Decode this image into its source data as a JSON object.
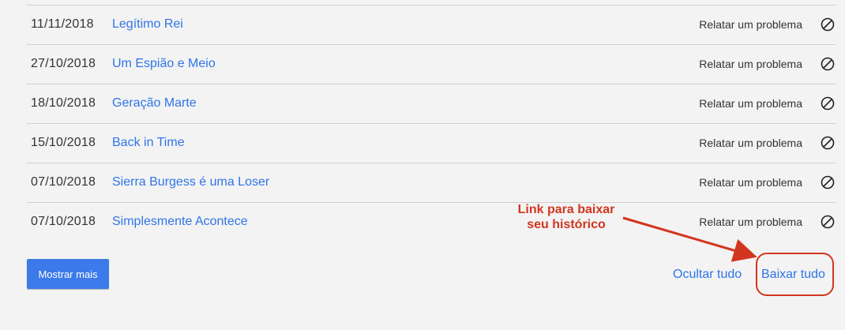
{
  "history": {
    "rows": [
      {
        "date": "11/11/2018",
        "title": "Legítimo Rei",
        "report": "Relatar um problema"
      },
      {
        "date": "27/10/2018",
        "title": "Um Espião e Meio",
        "report": "Relatar um problema"
      },
      {
        "date": "18/10/2018",
        "title": "Geração Marte",
        "report": "Relatar um problema"
      },
      {
        "date": "15/10/2018",
        "title": "Back in Time",
        "report": "Relatar um problema"
      },
      {
        "date": "07/10/2018",
        "title": "Sierra Burgess é uma Loser",
        "report": "Relatar um problema"
      },
      {
        "date": "07/10/2018",
        "title": "Simplesmente Acontece",
        "report": "Relatar um problema"
      }
    ]
  },
  "footer": {
    "show_more_label": "Mostrar mais",
    "hide_all_label": "Ocultar tudo",
    "download_all_label": "Baixar tudo"
  },
  "annotation": {
    "line1": "Link para baixar",
    "line2": "seu histórico"
  },
  "colors": {
    "link": "#2f74e8",
    "button": "#3d7ae9",
    "annotation": "#d2361f"
  },
  "icons": {
    "row_action": "hide-from-history-icon"
  }
}
